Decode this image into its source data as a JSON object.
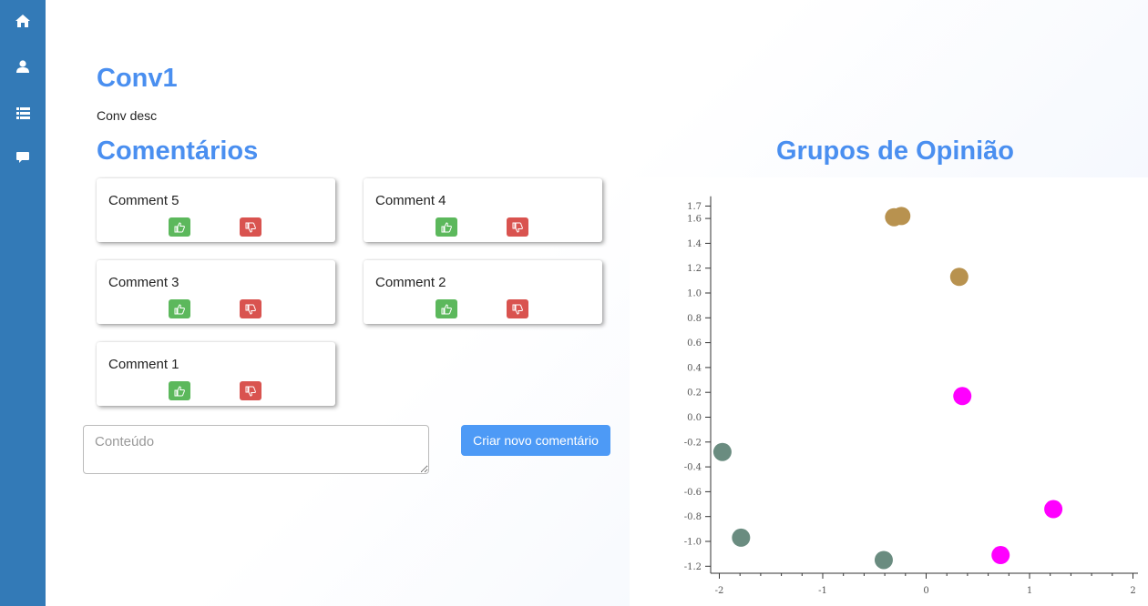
{
  "sidebar": {
    "items": [
      {
        "icon": "home-icon"
      },
      {
        "icon": "user-icon"
      },
      {
        "icon": "list-icon"
      },
      {
        "icon": "comment-icon"
      }
    ]
  },
  "conversation": {
    "title": "Conv1",
    "description": "Conv desc"
  },
  "comments_section": {
    "title": "Comentários",
    "comments": [
      {
        "text": "Comment 5"
      },
      {
        "text": "Comment 4"
      },
      {
        "text": "Comment 3"
      },
      {
        "text": "Comment 2"
      },
      {
        "text": "Comment 1"
      }
    ]
  },
  "new_comment": {
    "placeholder": "Conteúdo",
    "value": "",
    "submit_label": "Criar novo comentário"
  },
  "opinion_groups": {
    "title": "Grupos de Opinião"
  },
  "colors": {
    "sidebar": "#337ab7",
    "heading": "#4a8ff0",
    "upvote": "#5cb85c",
    "downvote": "#d9534f",
    "primary_button": "#4d9af6",
    "group_1": "#b8924f",
    "group_2": "#ff00ff",
    "group_3": "#6a8c80"
  },
  "chart_data": {
    "type": "scatter",
    "xlim": [
      -2.1,
      2.0
    ],
    "ylim": [
      -1.25,
      1.72
    ],
    "xticks": [
      -2,
      -1,
      0,
      1,
      2
    ],
    "yticks": [
      -1.2,
      -1.0,
      -0.8,
      -0.6,
      -0.4,
      -0.2,
      0.0,
      0.2,
      0.4,
      0.6,
      0.8,
      1.0,
      1.2,
      1.4,
      1.6,
      1.7
    ],
    "ytick_labels": [
      "-1.2",
      "-1.0",
      "-0.8",
      "-0.6",
      "-0.4",
      "-0.2",
      "0.0",
      "0.2",
      "0.4",
      "0.6",
      "0.8",
      "1.0",
      "1.2",
      "1.4",
      "1.6",
      "1.7"
    ],
    "series": [
      {
        "color": "#b8924f",
        "points": [
          [
            -0.31,
            1.61
          ],
          [
            -0.24,
            1.62
          ],
          [
            0.32,
            1.13
          ]
        ]
      },
      {
        "color": "#ff00ff",
        "points": [
          [
            0.35,
            0.17
          ],
          [
            0.72,
            -1.11
          ],
          [
            1.23,
            -0.74
          ]
        ]
      },
      {
        "color": "#6a8c80",
        "points": [
          [
            -1.97,
            -0.28
          ],
          [
            -1.79,
            -0.97
          ],
          [
            -0.41,
            -1.15
          ]
        ]
      }
    ]
  }
}
